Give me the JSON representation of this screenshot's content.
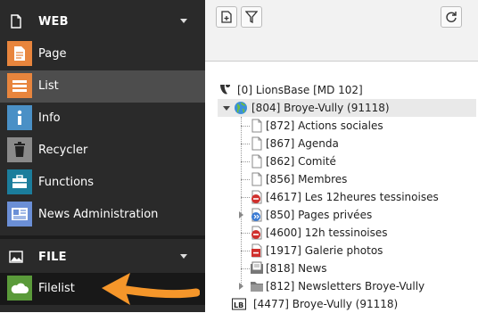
{
  "sidebar": {
    "web_group": {
      "title": "WEB",
      "icon": "document-icon"
    },
    "web_modules": [
      {
        "label": "Page",
        "icon": "page-module-icon",
        "color": "#e8853d"
      },
      {
        "label": "List",
        "icon": "list-module-icon",
        "color": "#e8853d"
      },
      {
        "label": "Info",
        "icon": "info-module-icon",
        "color": "#4a90c6"
      },
      {
        "label": "Recycler",
        "icon": "recycler-module-icon",
        "color": "#8a8a8a"
      },
      {
        "label": "Functions",
        "icon": "functions-module-icon",
        "color": "#1b7d9c"
      },
      {
        "label": "News Administration",
        "icon": "news-module-icon",
        "color": "#6b8fd6"
      }
    ],
    "file_group": {
      "title": "FILE",
      "icon": "image-icon"
    },
    "file_modules": [
      {
        "label": "Filelist",
        "icon": "filelist-module-icon",
        "color": "#5a9a3a"
      }
    ]
  },
  "tree": {
    "root": "[0] LionsBase [MD 102]",
    "site": "[804] Broye-Vully (91118)",
    "pages": [
      "[872] Actions sociales",
      "[867] Agenda",
      "[862] Comité",
      "[856] Membres",
      "[4617] Les 12heures tessinoises",
      "[850] Pages privées",
      "[4600] 12h tessinoises",
      "[1917] Galerie photos",
      "[818] News",
      "[812] Newsletters Broye-Vully"
    ],
    "next_site": "[4477] Broye-Vully (91118)"
  },
  "colors": {
    "accent_arrow": "#f5962a",
    "active_row": "#4d4d4d"
  }
}
